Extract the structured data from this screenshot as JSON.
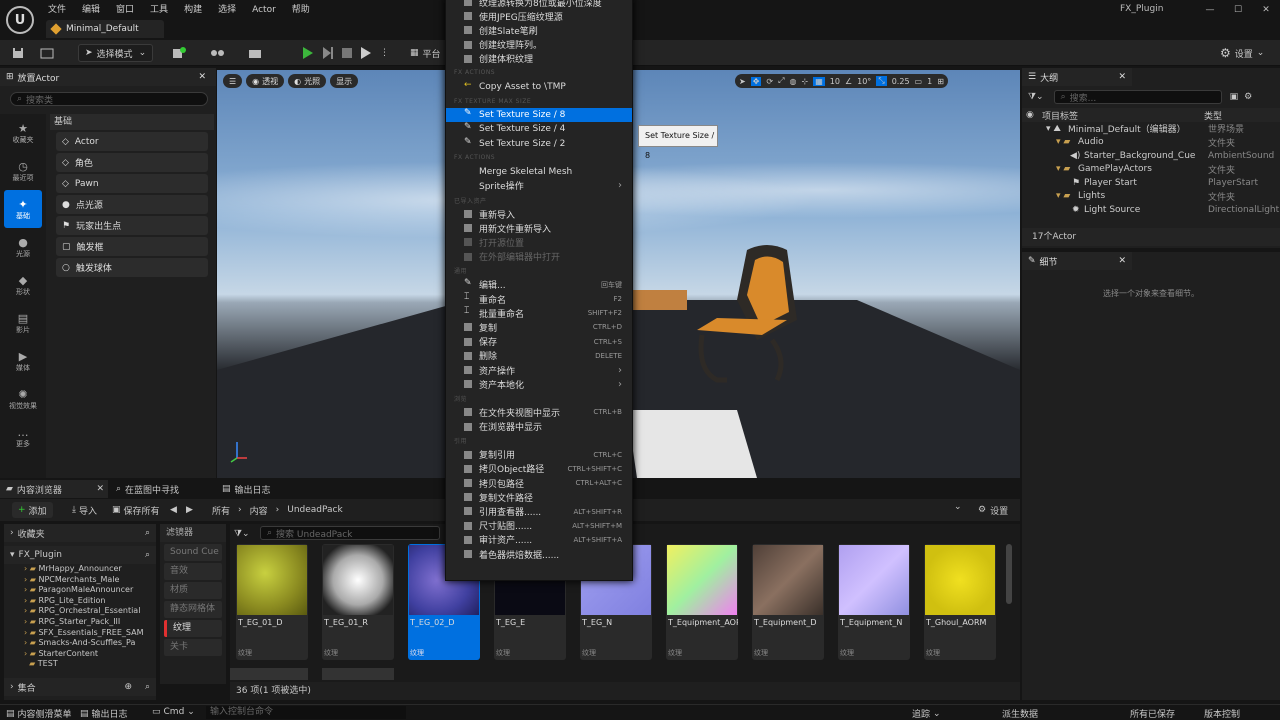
{
  "window": {
    "level_tab": "Minimal_Default",
    "title": "FX_Plugin"
  },
  "menubar": [
    "文件",
    "编辑",
    "窗口",
    "工具",
    "构建",
    "选择",
    "Actor",
    "帮助"
  ],
  "toolbar": {
    "select_mode": "选择模式",
    "platforms": "平台",
    "settings": "设置"
  },
  "place_actors": {
    "tab": "放置Actor",
    "search_placeholder": "搜索类",
    "section": "基础",
    "categories": [
      "收藏夹",
      "最近项",
      "基础",
      "光源",
      "形状",
      "影片",
      "媒体",
      "视觉效果",
      "更多"
    ],
    "items": [
      "Actor",
      "角色",
      "Pawn",
      "点光源",
      "玩家出生点",
      "触发框",
      "触发球体"
    ]
  },
  "viewport": {
    "view_mode": "透视",
    "lighting": "光照",
    "show": "显示",
    "grid_size": "10",
    "rot_snap": "10°",
    "scale_snap": "0.25",
    "cam_speed": "1"
  },
  "outliner": {
    "tab": "大纲",
    "search_placeholder": "搜索...",
    "col_label": "项目标签",
    "col_type": "类型",
    "rows": [
      {
        "name": "Minimal_Default（编辑器）",
        "type": "世界场景",
        "depth": 0
      },
      {
        "name": "Audio",
        "type": "文件夹",
        "depth": 1
      },
      {
        "name": "Starter_Background_Cue",
        "type": "AmbientSound",
        "depth": 2
      },
      {
        "name": "GamePlayActors",
        "type": "文件夹",
        "depth": 1
      },
      {
        "name": "Player Start",
        "type": "PlayerStart",
        "depth": 2
      },
      {
        "name": "Lights",
        "type": "文件夹",
        "depth": 1
      },
      {
        "name": "Light Source",
        "type": "DirectionalLight",
        "depth": 2
      }
    ],
    "count": "17个Actor"
  },
  "details": {
    "tab": "细节",
    "empty": "选择一个对象来查看细节。"
  },
  "content_browser": {
    "tabs": [
      "内容浏览器",
      "在蓝图中寻找",
      "输出日志"
    ],
    "add": "添加",
    "import": "导入",
    "save_all": "保存所有",
    "path": [
      "所有",
      "内容",
      "UndeadPack"
    ],
    "settings": "设置",
    "favorites": "收藏夹",
    "root": "FX_Plugin",
    "folders": [
      "MrHappy_Announcer",
      "NPCMerchants_Male",
      "ParagonMaleAnnouncer",
      "RPG_Lite_Edition",
      "RPG_Orchestral_Essential",
      "RPG_Starter_Pack_III",
      "SFX_Essentials_FREE_SAM",
      "Smacks-And-Scuffles_Pa",
      "StarterContent",
      "TEST"
    ],
    "collections": "集合",
    "filter_label": "滤镜器",
    "filters": [
      "Sound Cue",
      "音效",
      "材质",
      "静态网格体",
      "纹理",
      "关卡"
    ],
    "search_placeholder": "搜索 UndeadPack",
    "assets": [
      {
        "name": "T_EG_01_D",
        "kind": "纹理"
      },
      {
        "name": "T_EG_01_R",
        "kind": "纹理"
      },
      {
        "name": "T_EG_02_D",
        "kind": "纹理",
        "selected": true
      },
      {
        "name": "T_EG_E",
        "kind": "纹理"
      },
      {
        "name": "T_EG_N",
        "kind": "纹理"
      },
      {
        "name": "T_Equipment_AORM",
        "kind": "纹理"
      },
      {
        "name": "T_Equipment_D",
        "kind": "纹理"
      },
      {
        "name": "T_Equipment_N",
        "kind": "纹理"
      },
      {
        "name": "T_Ghoul_AORM",
        "kind": "纹理"
      }
    ],
    "status": "36 项(1 项被选中)"
  },
  "statusbar": {
    "drawer": "内容侧滑菜单",
    "output": "输出日志",
    "cmd": "Cmd",
    "cmd_placeholder": "输入控制台命令",
    "trace": "追踪",
    "derived": "派生数据",
    "save_all": "所有已保存",
    "source_control": "版本控制"
  },
  "context_menu": {
    "top_items": [
      "纹理源转换为8位或最小位深度",
      "使用JPEG压缩纹理源",
      "创建Slate笔刷",
      "创建纹理阵列。",
      "创建体积纹理"
    ],
    "sec_fx": "FX ACTIONS",
    "copy_tmp": "Copy Asset to \\TMP",
    "sec_max": "FX TEXTURE MAX SIZE",
    "sizes": [
      "Set Texture Size / 8",
      "Set Texture Size / 4",
      "Set Texture Size / 2"
    ],
    "sec_fx2": "FX ACTIONS",
    "merge": "Merge Skeletal Mesh",
    "sprite": "Sprite操作",
    "sec_import": "已导入资产",
    "reimport": [
      "重新导入",
      "用新文件重新导入",
      "打开源位置",
      "在外部编辑器中打开"
    ],
    "sec_common": "通用",
    "common": [
      {
        "label": "编辑...",
        "sc": "回车键"
      },
      {
        "label": "重命名",
        "sc": "F2"
      },
      {
        "label": "批量重命名",
        "sc": "SHIFT+F2"
      },
      {
        "label": "复制",
        "sc": "CTRL+D"
      },
      {
        "label": "保存",
        "sc": "CTRL+S"
      },
      {
        "label": "删除",
        "sc": "DELETE"
      },
      {
        "label": "资产操作",
        "sc": "›"
      },
      {
        "label": "资产本地化",
        "sc": "›"
      }
    ],
    "sec_explore": "浏览",
    "explore": [
      {
        "label": "在文件夹视图中显示",
        "sc": "CTRL+B"
      },
      {
        "label": "在浏览器中显示",
        "sc": ""
      }
    ],
    "sec_ref": "引用",
    "refs": [
      {
        "label": "复制引用",
        "sc": "CTRL+C"
      },
      {
        "label": "拷贝Object路径",
        "sc": "CTRL+SHIFT+C"
      },
      {
        "label": "拷贝包路径",
        "sc": "CTRL+ALT+C"
      },
      {
        "label": "复制文件路径",
        "sc": ""
      },
      {
        "label": "引用查看器......",
        "sc": "ALT+SHIFT+R"
      },
      {
        "label": "尺寸贴图......",
        "sc": "ALT+SHIFT+M"
      },
      {
        "label": "审计资产......",
        "sc": "ALT+SHIFT+A"
      },
      {
        "label": "着色器烘焙数据......",
        "sc": ""
      }
    ],
    "tooltip": "Set Texture Size / 8"
  }
}
